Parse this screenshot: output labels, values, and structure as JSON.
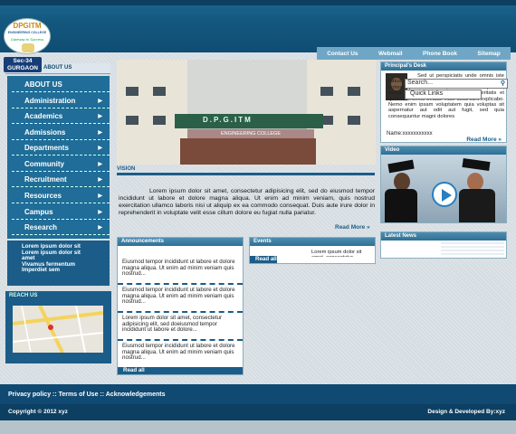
{
  "logo": {
    "name": "DPGITM",
    "subtitle": "ENGINEERING COLLEGE",
    "tagline": "Gateway to Success"
  },
  "location_badge": {
    "line1": "Sec-34",
    "line2": "GURGAON"
  },
  "sidebar": {
    "header": "ABOUT US",
    "items": [
      {
        "label": "ABOUT US",
        "has_arrow": false
      },
      {
        "label": "Administration",
        "has_arrow": true
      },
      {
        "label": "Academics",
        "has_arrow": true
      },
      {
        "label": "Admissions",
        "has_arrow": true
      },
      {
        "label": "Departments",
        "has_arrow": true
      },
      {
        "label": "Community",
        "has_arrow": true
      },
      {
        "label": "Recruitment",
        "has_arrow": true
      },
      {
        "label": "Resources",
        "has_arrow": true
      },
      {
        "label": "Campus",
        "has_arrow": true
      },
      {
        "label": "Research",
        "has_arrow": true
      }
    ]
  },
  "news_scroller": [
    "Lorem ipsum dolor sit",
    "Lorem ipsum dolor sit",
    "amet",
    "Vivamus fermentum",
    "Imperdiet sem"
  ],
  "reach_us": {
    "title": "REACH US"
  },
  "topnav": [
    "Contact Us",
    "Webmail",
    "Phone Book",
    "Sitemap"
  ],
  "banner": {
    "sign1": "D.P.G.ITM",
    "sign2": "ENGINEERING COLLEGE"
  },
  "vision": {
    "title": "VISION",
    "text": "Lorem ipsum dolor sit amet, consectetur adipisicing elit, sed do eiusmod tempor incididunt ut labore et dolore magna aliqua. Ut enim ad minim veniam, quis nostrud exercitation ullamco laboris nisi ut aliquip ex ea commodo consequat. Duis aute irure dolor in reprehenderit in voluptate velit esse cillum dolore eu fugiat nulla pariatur.",
    "read_more": "Read More »"
  },
  "principal": {
    "title": "Principal's Desk",
    "text": "Sed ut perspiciatis unde omnis iste natus error sit voluptatem accusantium doloremque laudantium, totam rem aperiam, eaque ipsa quae ab illo inventore veritatis et quasi architecto beatae vitae dicta sunt explicabo. Nemo enim ipsam voluptatem quia voluptas sit aspernatur aut odit aut fugit, sed quia consequuntur magni dolores",
    "name": "Name:xxxxxxxxxxx",
    "read_more": "Read More »"
  },
  "search": {
    "placeholder": "Search..."
  },
  "quick_links": {
    "label": "Quick Links"
  },
  "video": {
    "title": "Video"
  },
  "announcements": {
    "title": "Announcements",
    "entries": [
      "Eiusmod tempor incididunt ut labore et dolore magna aliqua. Ut enim ad minim veniam quis nostrud...",
      "Eiusmod tempor incididunt ut labore et dolore magna aliqua. Ut enim ad minim veniam quis nostrud...",
      "Lorem ipsum dolor sit amet, consectetur adipisicing elit, sed doeiusmod tempor incididunt ut labore et dolore...",
      "Eiusmod tempor incididunt ut labore et dolore magna aliqua. Ut enim ad minim veniam quis nostrud..."
    ],
    "read_all": "Read all"
  },
  "events": {
    "title": "Events",
    "item": "Lorem ipsum dolor sit amet, consectetur adipisicing elit",
    "read_all": "Read all"
  },
  "latest_news": {
    "title": "Latest News"
  },
  "footer": {
    "links": "Privacy policy :: Terms of Use :: Acknowledgements",
    "copyright": "Copyright © 2012 xyz",
    "credit": "Design & Developed By:xyz"
  },
  "colors": {
    "primary": "#1b5d88",
    "header": "#14587f",
    "accent": "#6fa6c5"
  }
}
